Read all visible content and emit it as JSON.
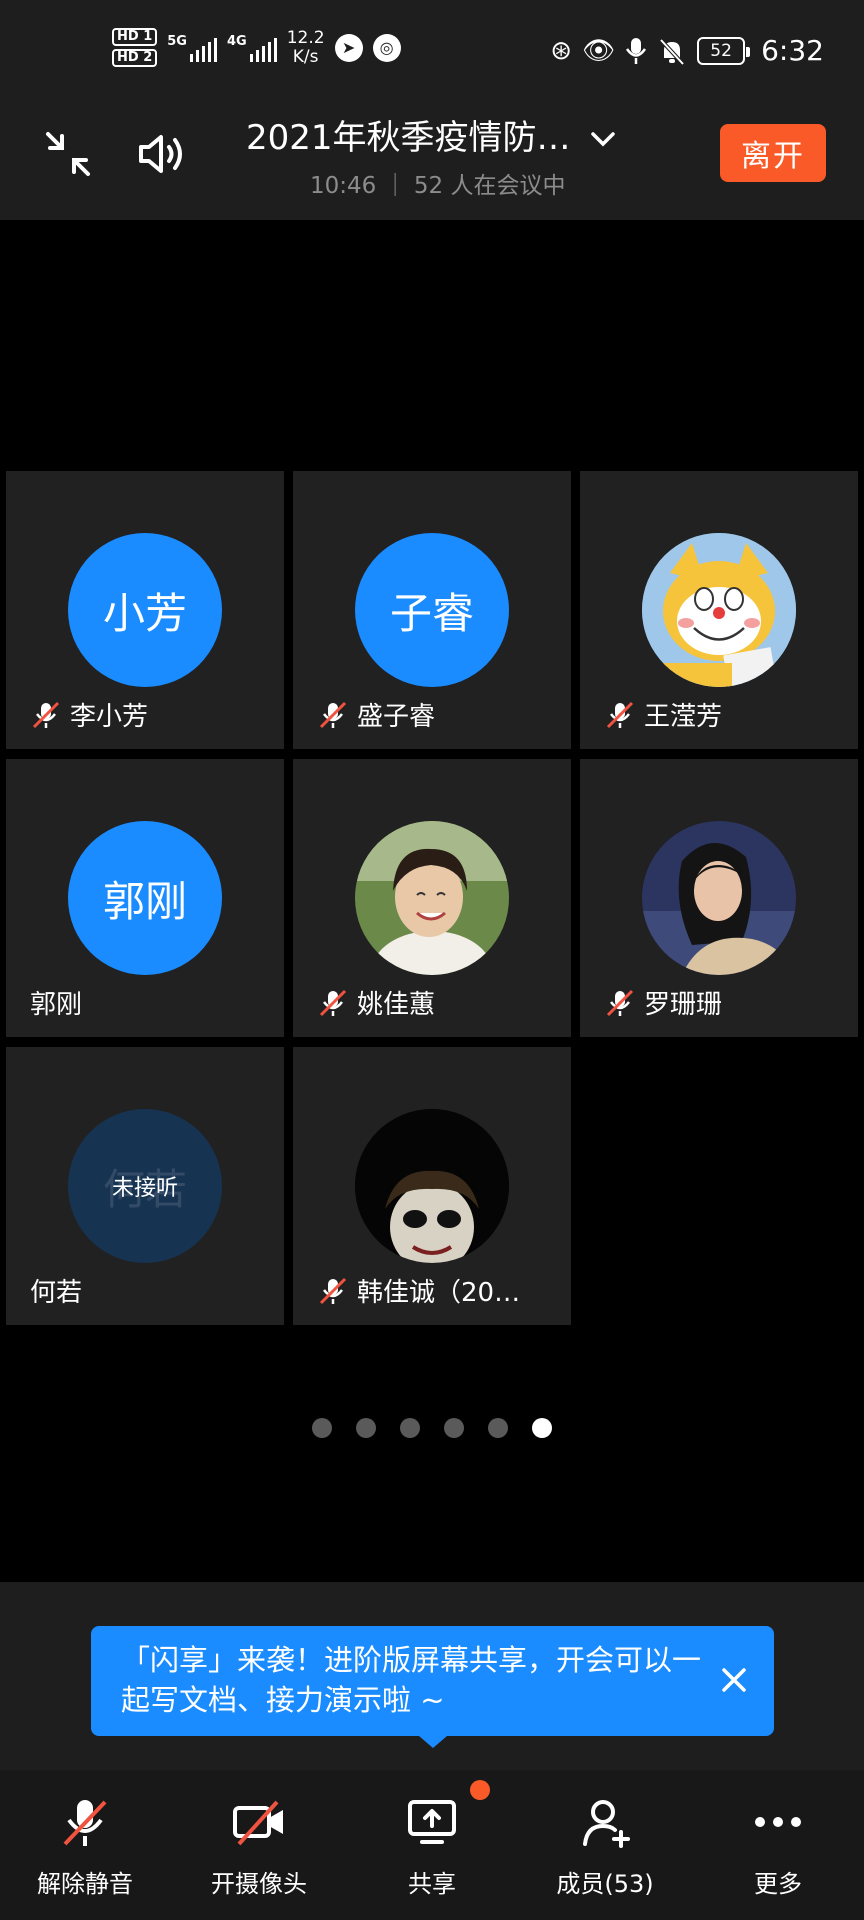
{
  "status_bar": {
    "hd1": "HD 1",
    "hd2": "HD 2",
    "net1": "5G",
    "net2": "4G",
    "speed_value": "12.2",
    "speed_unit": "K/s",
    "battery": "52",
    "time": "6:32"
  },
  "header": {
    "title": "2021年秋季疫情防…",
    "subtitle": "10:46 ｜ 52 人在会议中",
    "leave": "离开"
  },
  "participants": [
    {
      "avatar_text": "小芳",
      "name": "李小芳",
      "muted": true,
      "avatar": "text"
    },
    {
      "avatar_text": "子睿",
      "name": "盛子睿",
      "muted": true,
      "avatar": "text"
    },
    {
      "avatar_text": "",
      "name": "王滢芳",
      "muted": true,
      "avatar": "cartoon-cat-photo"
    },
    {
      "avatar_text": "郭刚",
      "name": "郭刚",
      "muted": false,
      "avatar": "text"
    },
    {
      "avatar_text": "",
      "name": "姚佳蕙",
      "muted": true,
      "avatar": "girl-photo"
    },
    {
      "avatar_text": "",
      "name": "罗珊珊",
      "muted": true,
      "avatar": "woman-photo"
    },
    {
      "avatar_text": "何若",
      "status": "未接听",
      "name": "何若",
      "muted": false,
      "avatar": "text-dim"
    },
    {
      "avatar_text": "",
      "name": "韩佳诚（20…",
      "muted": true,
      "avatar": "joker-photo"
    }
  ],
  "pagination": {
    "total": 6,
    "current": 6
  },
  "banner": {
    "text": "「闪享」来袭！进阶版屏幕共享，开会可以一起写文档、接力演示啦 ~"
  },
  "toolbar": {
    "unmute": "解除静音",
    "camera": "开摄像头",
    "share": "共享",
    "members": "成员(53)",
    "more": "更多"
  },
  "colors": {
    "accent_blue": "#1a8cff",
    "leave_orange": "#fa5a28",
    "mute_red": "#f0533f",
    "tile_bg": "#212121"
  }
}
